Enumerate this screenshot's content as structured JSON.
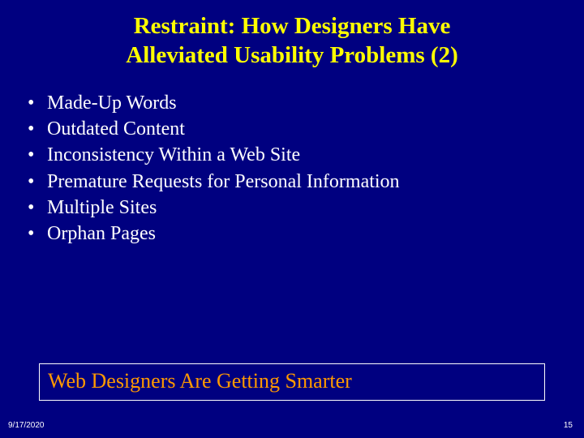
{
  "title": {
    "line1": "Restraint:  How Designers Have",
    "line2": "Alleviated Usability Problems (2)"
  },
  "bullets": [
    "Made-Up Words",
    "Outdated Content",
    "Inconsistency Within a Web Site",
    "Premature Requests for Personal Information",
    "Multiple Sites",
    "Orphan Pages"
  ],
  "callout": "Web Designers Are Getting Smarter",
  "footer": {
    "date": "9/17/2020",
    "page": "15"
  }
}
